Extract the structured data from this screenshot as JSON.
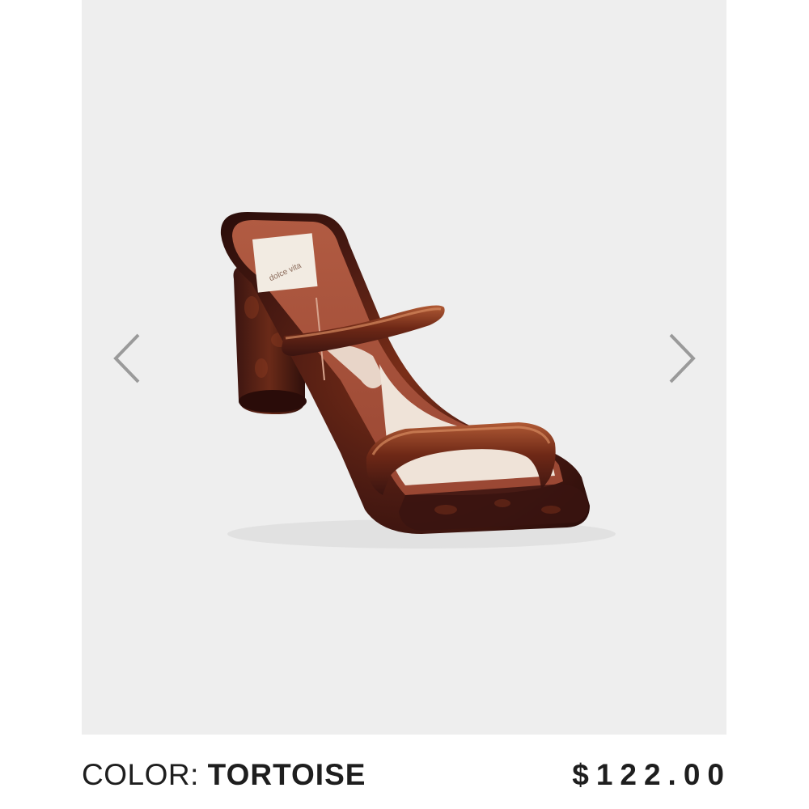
{
  "product": {
    "brand_logo_text": "dolce vita",
    "color_label": "COLOR: ",
    "color_value": "TORTOISE",
    "price": "$122.00"
  },
  "gallery": {
    "prev_icon": "chevron-left-icon",
    "next_icon": "chevron-right-icon"
  },
  "colors": {
    "gallery_background": "#eeeeee",
    "tortoise_dark": "#3a1510",
    "tortoise_amber": "#8a3a1f",
    "insole": "#a5513a",
    "lining": "#efe3d8",
    "text": "#1e1e1e",
    "arrow": "#9a9a9a"
  }
}
